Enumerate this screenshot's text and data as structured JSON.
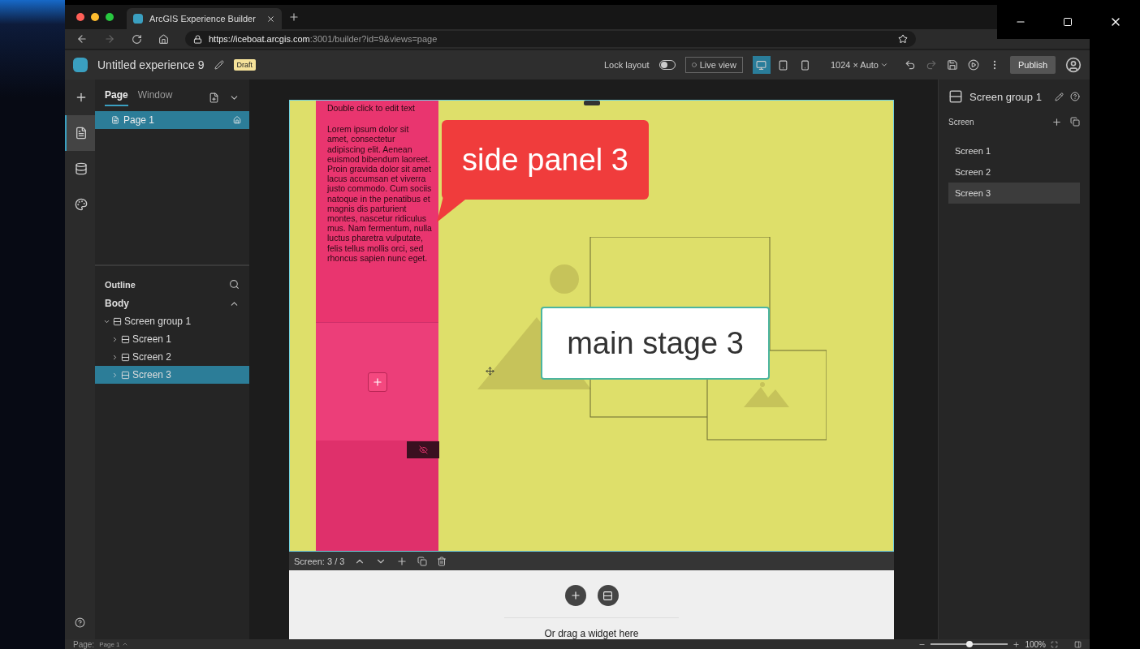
{
  "browser": {
    "tab_title": "ArcGIS Experience Builder",
    "url_host": "https://iceboat.arcgis.com",
    "url_rest": ":3001/builder?id=9&views=page"
  },
  "header": {
    "title": "Untitled experience 9",
    "badge": "Draft",
    "lock_label": "Lock layout",
    "lock_on": false,
    "live_view": "Live view",
    "size": "1024 × Auto",
    "publish": "Publish",
    "devices": [
      {
        "kind": "desktop",
        "selected": true
      },
      {
        "kind": "tablet",
        "selected": false
      },
      {
        "kind": "phone",
        "selected": false
      }
    ]
  },
  "left_rail": [
    {
      "kind": "add",
      "selected": false
    },
    {
      "kind": "page",
      "selected": true
    },
    {
      "kind": "data",
      "selected": false
    },
    {
      "kind": "theme",
      "selected": false
    }
  ],
  "page_panel": {
    "tabs": [
      {
        "label": "Page",
        "selected": true
      },
      {
        "label": "Window",
        "selected": false
      }
    ],
    "pages": [
      {
        "label": "Page 1",
        "selected": true
      }
    ]
  },
  "outline": {
    "title": "Outline",
    "section": "Body",
    "tree": [
      {
        "label": "Screen group 1",
        "expanded": true,
        "selected": false,
        "children": [
          {
            "label": "Screen 1",
            "expanded": false,
            "selected": false
          },
          {
            "label": "Screen 2",
            "expanded": false,
            "selected": false
          },
          {
            "label": "Screen 3",
            "expanded": false,
            "selected": true
          }
        ]
      }
    ]
  },
  "canvas": {
    "text_title": "Double click to edit text",
    "text_body": "Lorem ipsum dolor sit amet, consectetur adipiscing elit. Aenean euismod bibendum laoreet. Proin gravida dolor sit amet lacus accumsan et viverra justo commodo. Cum sociis natoque in the penatibus et magnis dis parturient montes, nascetur ridiculus mus. Nam fermentum, nulla luctus pharetra vulputate, felis tellus mollis orci, sed rhoncus sapien nunc eget.",
    "callout": "side panel 3",
    "stage_label": "main stage 3",
    "screen_counter": "Screen: 3 / 3",
    "drop_hint": "Or drag a widget here"
  },
  "right_panel": {
    "title": "Screen group 1",
    "section": "Screen",
    "screens": [
      {
        "label": "Screen 1",
        "selected": false
      },
      {
        "label": "Screen 2",
        "selected": false
      },
      {
        "label": "Screen 3",
        "selected": true
      }
    ]
  },
  "status_bar": {
    "page_label": "Page:",
    "page_value": "Page 1",
    "zoom": "100%",
    "zoom_slider": {
      "level": 0.5
    }
  }
}
